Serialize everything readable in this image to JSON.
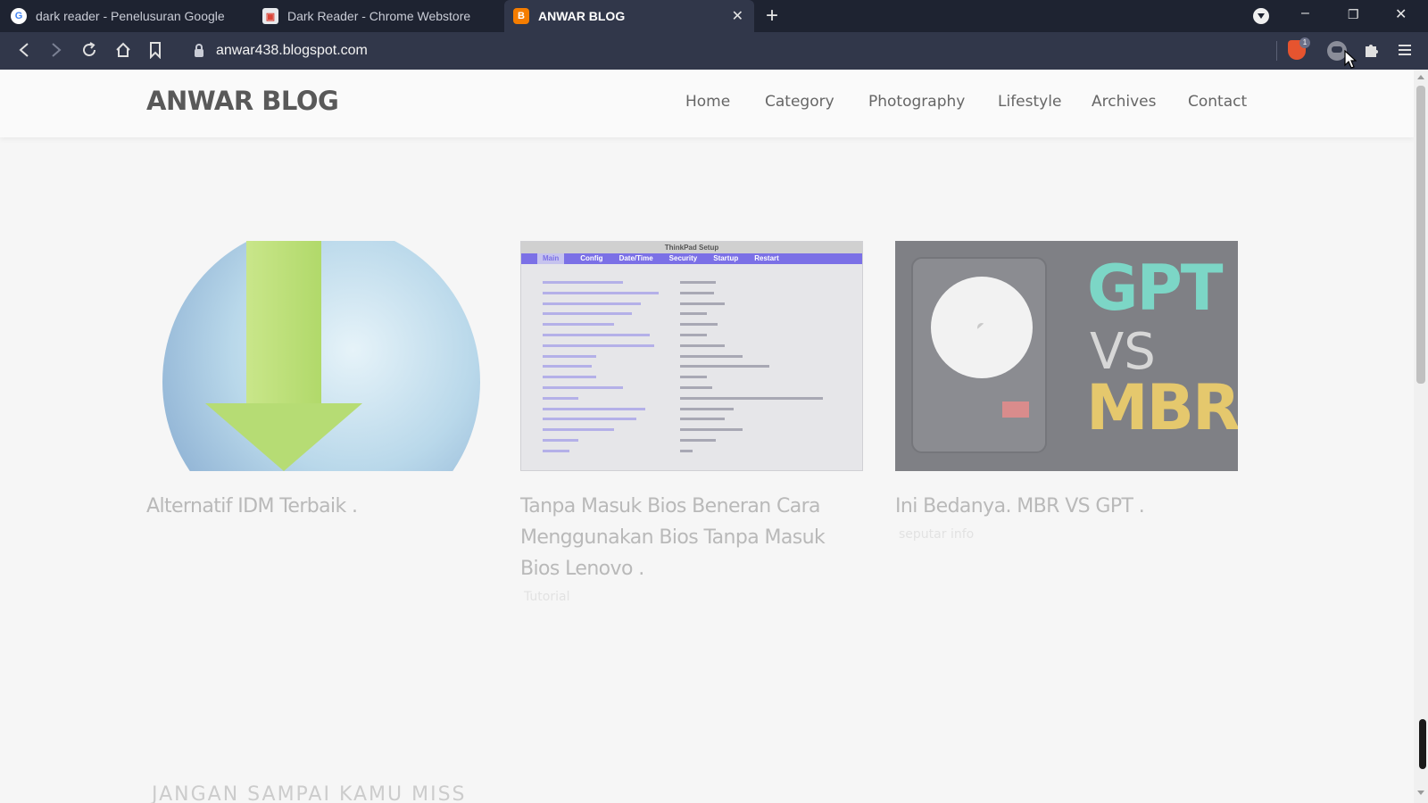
{
  "browser": {
    "tabs": [
      {
        "title": "dark reader - Penelusuran Google",
        "favicon": "google-icon",
        "active": false
      },
      {
        "title": "Dark Reader - Chrome Webstore",
        "favicon": "chrome-webstore-icon",
        "active": false
      },
      {
        "title": "ANWAR BLOG",
        "favicon": "blogger-icon",
        "active": true
      }
    ],
    "tab_close_glyph": "✕",
    "new_tab_glyph": "+",
    "url": "anwar438.blogspot.com",
    "brave_badge": "1",
    "controls": {
      "minimize": "–",
      "restore": "❐",
      "close": "✕"
    },
    "colors": {
      "tabbar": "#1e2331",
      "toolbar": "#31374a"
    }
  },
  "site": {
    "logo": "ANWAR BLOG",
    "nav": [
      "Home",
      "Category",
      "Photography",
      "Lifestyle",
      "Archives",
      "Contact"
    ],
    "posts": [
      {
        "title": "Alternatif IDM Terbaik .",
        "label": "",
        "thumbnail": "globe-download-icon"
      },
      {
        "title": "Tanpa Masuk Bios Beneran Cara Menggunakan Bios Tanpa Masuk Bios Lenovo .",
        "label": "Tutorial",
        "thumbnail": "bios-setup-screen"
      },
      {
        "title": "Ini Bedanya. MBR VS GPT .",
        "label": "seputar info",
        "thumbnail": "gpt-vs-mbr-disk"
      }
    ],
    "bios_thumbnail": {
      "header": "ThinkPad Setup",
      "menu": [
        "Main",
        "Config",
        "Date/Time",
        "Security",
        "Startup",
        "Restart"
      ]
    },
    "gpt_thumbnail": {
      "top": "GPT",
      "middle": "VS",
      "bottom": "MBR"
    },
    "section_heading": "JANGAN SAMPAI KAMU MISS"
  }
}
